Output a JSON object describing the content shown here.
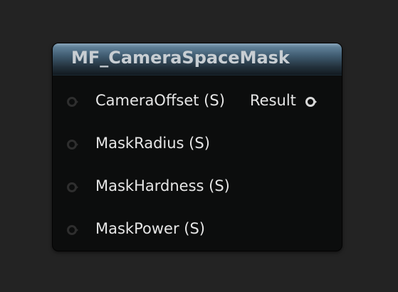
{
  "node": {
    "title": "MF_CameraSpaceMask",
    "inputs": [
      {
        "label": "CameraOffset (S)",
        "connected": false
      },
      {
        "label": "MaskRadius (S)",
        "connected": false
      },
      {
        "label": "MaskHardness (S)",
        "connected": false
      },
      {
        "label": "MaskPower (S)",
        "connected": false
      }
    ],
    "outputs": [
      {
        "label": "Result",
        "connected": false
      }
    ]
  },
  "colors": {
    "canvas_background": "#232323",
    "node_body": "#0c0d0d",
    "header_accent": "#5f7f97",
    "title_text": "#c8ced3",
    "pin_label_text": "#e6e6e6",
    "input_pin_idle": "#2e2e2e",
    "output_pin": "#d8d8d8"
  }
}
